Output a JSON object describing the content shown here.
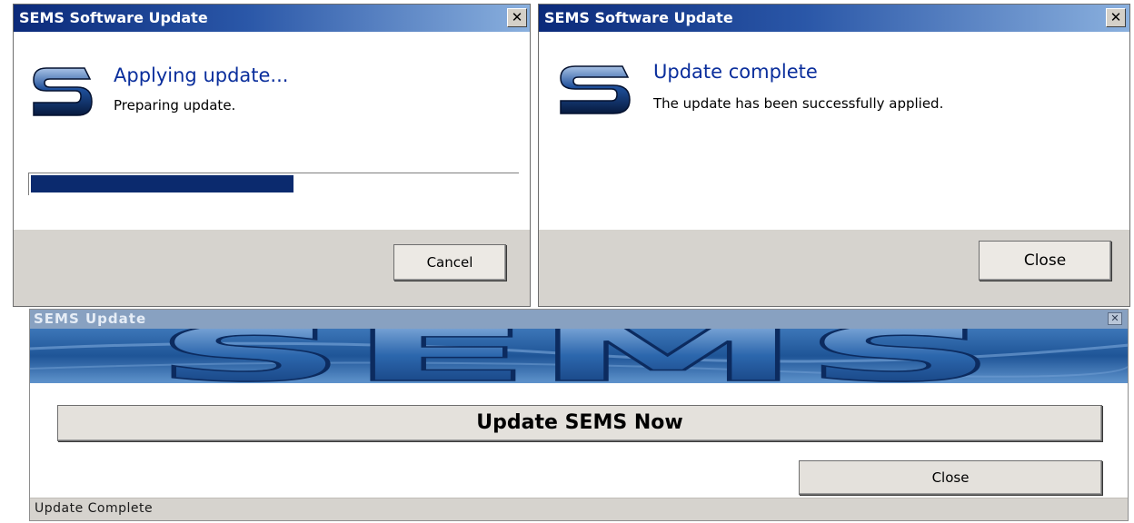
{
  "windows": {
    "applying": {
      "title": "SEMS Software Update",
      "close_glyph": "✕",
      "logo_icon": "sems-s-logo-icon",
      "heading": "Applying update...",
      "message": "Preparing update.",
      "progress_percent": 54,
      "cancel_label": "Cancel"
    },
    "complete": {
      "title": "SEMS Software Update",
      "close_glyph": "✕",
      "logo_icon": "sems-s-logo-icon",
      "heading": "Update complete",
      "message": "The update has been successfully applied.",
      "close_label": "Close"
    },
    "updater": {
      "title": "SEMS Update",
      "close_glyph": "✕",
      "banner_text": "SEMS",
      "update_now_label": "Update SEMS Now",
      "close_label": "Close",
      "status": "Update Complete"
    }
  },
  "colors": {
    "titlebar_dark": "#0b2a7a",
    "heading_blue": "#0a2e9c",
    "progress_fill": "#0b2a6e",
    "dialog_footer": "#d6d3ce"
  }
}
